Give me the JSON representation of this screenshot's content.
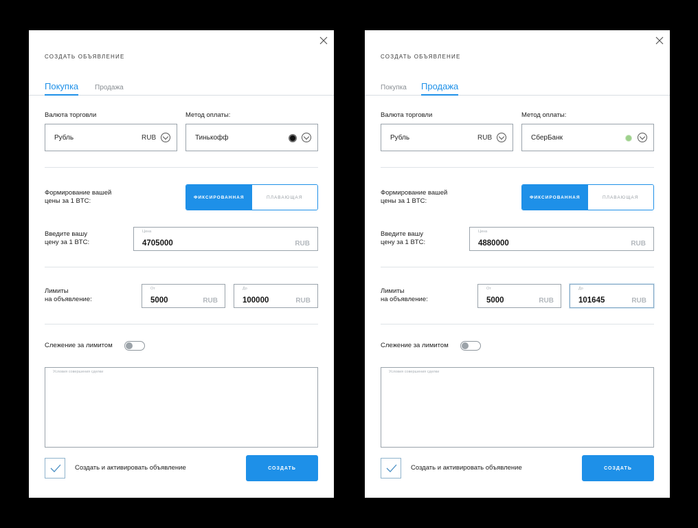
{
  "colors": {
    "accent": "#1e90e8",
    "border": "#9aa3ab",
    "muted": "#b3b8bd"
  },
  "forms": [
    {
      "title": "создать объявление",
      "tabs": [
        {
          "label": "Покупка",
          "active": true
        },
        {
          "label": "Продажа",
          "active": false
        }
      ],
      "currency": {
        "label": "Валюта торговли",
        "value": "Рубль",
        "code": "RUB"
      },
      "payment": {
        "label": "Метод оплаты:",
        "value": "Тинькофф",
        "icon": "tinkoff-logo-icon"
      },
      "price_mode": {
        "label_line1": "Формирование вашей",
        "label_line2": "цены за 1 BTC:",
        "options": [
          "фиксированная",
          "плавающая"
        ],
        "selected": "фиксированная"
      },
      "price": {
        "label_line1": "Введите вашу",
        "label_line2": "цену за 1 BTC:",
        "placeholder": "Цена",
        "value": "4705000",
        "unit": "RUB"
      },
      "limits": {
        "label_line1": "Лимиты",
        "label_line2": "на объявление:",
        "from": {
          "placeholder": "От",
          "value": "5000",
          "unit": "RUB"
        },
        "to": {
          "placeholder": "До",
          "value": "100000",
          "unit": "RUB"
        }
      },
      "tracking": {
        "label": "Слежение за лимитом",
        "on": false
      },
      "conditions": {
        "placeholder": "Условия совершения сделки"
      },
      "activate": {
        "label": "Создать и активировать объявление",
        "checked": true
      },
      "submit": {
        "label": "создать"
      }
    },
    {
      "title": "создать объявление",
      "tabs": [
        {
          "label": "Покупка",
          "active": false
        },
        {
          "label": "Продажа",
          "active": true
        }
      ],
      "currency": {
        "label": "Валюта торговли",
        "value": "Рубль",
        "code": "RUB"
      },
      "payment": {
        "label": "Метод оплаты:",
        "value": "СберБанк",
        "icon": "sberbank-logo-icon"
      },
      "price_mode": {
        "label_line1": "Формирование вашей",
        "label_line2": "цены за 1 BTC:",
        "options": [
          "фиксированная",
          "плавающая"
        ],
        "selected": "фиксированная"
      },
      "price": {
        "label_line1": "Введите вашу",
        "label_line2": "цену за 1 BTC:",
        "placeholder": "Цена",
        "value": "4880000",
        "unit": "RUB"
      },
      "limits": {
        "label_line1": "Лимиты",
        "label_line2": "на объявление:",
        "from": {
          "placeholder": "От",
          "value": "5000",
          "unit": "RUB"
        },
        "to": {
          "placeholder": "До",
          "value": "101645",
          "unit": "RUB"
        }
      },
      "tracking": {
        "label": "Слежение за лимитом",
        "on": false
      },
      "conditions": {
        "placeholder": "Условия совершения сделки"
      },
      "activate": {
        "label": "Создать и активировать объявление",
        "checked": true
      },
      "submit": {
        "label": "создать"
      }
    }
  ]
}
